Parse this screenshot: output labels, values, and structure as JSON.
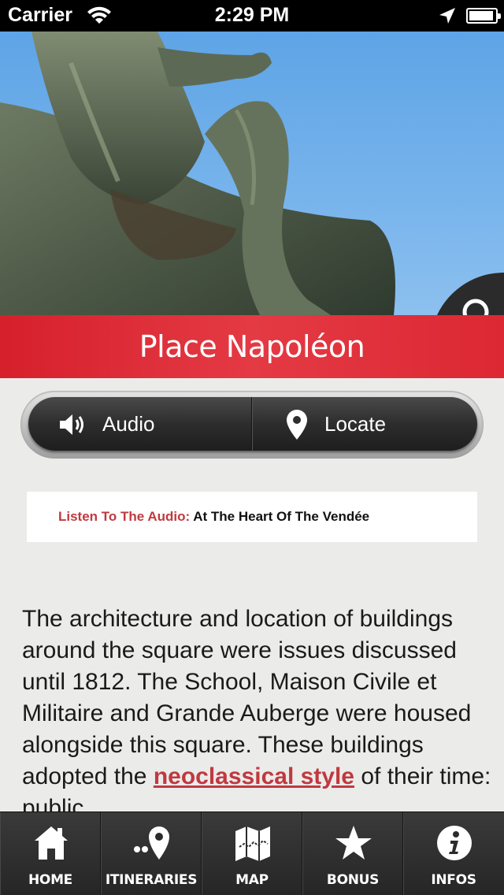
{
  "status_bar": {
    "carrier": "Carrier",
    "time": "2:29 PM"
  },
  "hero": {
    "search_icon": "search-icon"
  },
  "title": "Place Napoléon",
  "segmented": {
    "audio_label": "Audio",
    "locate_label": "Locate"
  },
  "audio_banner": {
    "label": "Listen To The Audio:",
    "value": "At The Heart Of The Vendée"
  },
  "body": {
    "text_before_link": "The architecture and location of buildings around the square were issues discussed until 1812. The School, Maison Civile et Militaire and Grande Auberge were housed alongside this square. These buildings adopted the ",
    "link": "neoclassical style",
    "text_after_link": " of their time: public"
  },
  "tabs": [
    {
      "label": "HOME",
      "icon": "home-icon"
    },
    {
      "label": "ITINERARIES",
      "icon": "itinerary-pin-icon"
    },
    {
      "label": "MAP",
      "icon": "map-icon"
    },
    {
      "label": "BONUS",
      "icon": "star-icon"
    },
    {
      "label": "INFOS",
      "icon": "info-icon"
    }
  ],
  "colors": {
    "accent_red": "#d6202c",
    "link_red": "#c0393f",
    "tabbar": "#2b2b2b"
  }
}
